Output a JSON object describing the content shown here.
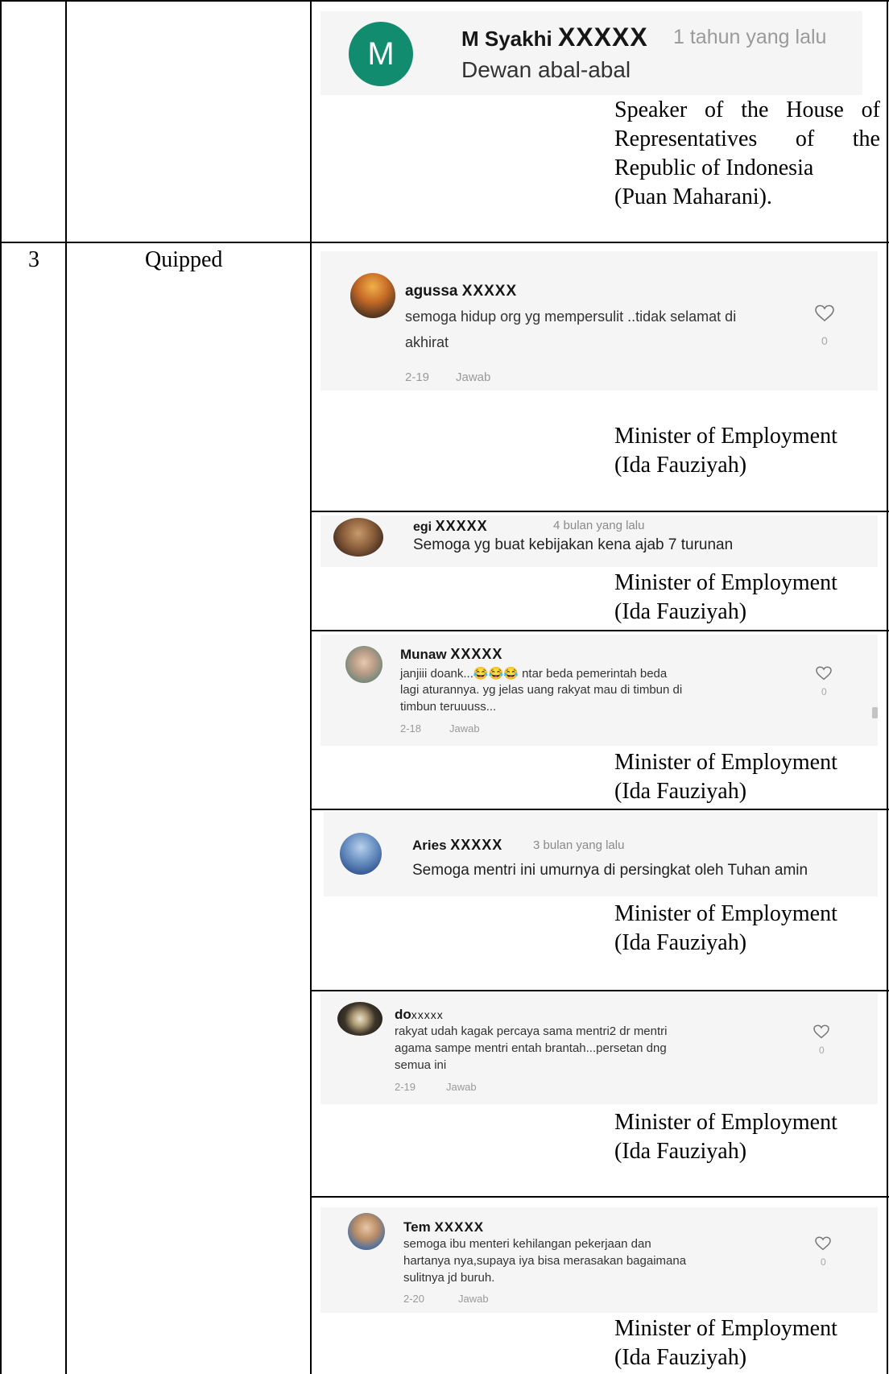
{
  "row_prev": {
    "comment": {
      "avatar_letter": "M",
      "avatar_color": "#128c6e",
      "username": "M Syakhi",
      "masked": "XXXXX",
      "time_ago": "1 tahun yang lalu",
      "text": "Dewan abal-abal"
    },
    "caption_lines": [
      [
        "Speaker",
        "of",
        "the",
        "House",
        "of"
      ],
      [
        "Representatives",
        "of",
        "the"
      ],
      [
        "Republic of Indonesia"
      ],
      [
        "(Puan Maharani)."
      ]
    ]
  },
  "row3": {
    "number": "3",
    "category": "Quipped",
    "caption_line1": "Minister of Employment",
    "caption_line2": "(Ida Fauziyah)",
    "items": [
      {
        "username": "agussa",
        "masked": "XXXXX",
        "text_lines": [
          "semoga hidup org yg mempersulit ..tidak selamat di",
          "akhirat"
        ],
        "date": "2-19",
        "reply": "Jawab",
        "likes": "0"
      },
      {
        "username": "egi",
        "masked": "XXXXX",
        "time_ago": "4 bulan yang lalu",
        "text": "Semoga yg buat kebijakan kena ajab 7 turunan"
      },
      {
        "username": "Munaw",
        "masked": "XXXXX",
        "text_lines": [
          "janjiii doank...😂😂😂 ntar beda pemerintah beda",
          "lagi aturannya. yg jelas uang rakyat mau di timbun di",
          "timbun teruuuss..."
        ],
        "date": "2-18",
        "reply": "Jawab",
        "likes": "0"
      },
      {
        "username": "Aries",
        "masked": "XXXXX",
        "time_ago": "3 bulan yang lalu",
        "text": "Semoga mentri ini umurnya di persingkat oleh Tuhan amin"
      },
      {
        "username": "do",
        "masked": "xxxxx",
        "text_lines": [
          "rakyat udah kagak percaya sama mentri2 dr mentri",
          "agama sampe mentri entah brantah...persetan dng",
          "semua ini"
        ],
        "date": "2-19",
        "reply": "Jawab",
        "likes": "0"
      },
      {
        "username": "Tem",
        "masked": "XXXXX",
        "text_lines": [
          "semoga ibu menteri kehilangan pekerjaan dan",
          "hartanya nya,supaya iya bisa merasakan bagaimana",
          "sulitnya jd buruh."
        ],
        "date": "2-20",
        "reply": "Jawab",
        "likes": "0"
      }
    ]
  }
}
